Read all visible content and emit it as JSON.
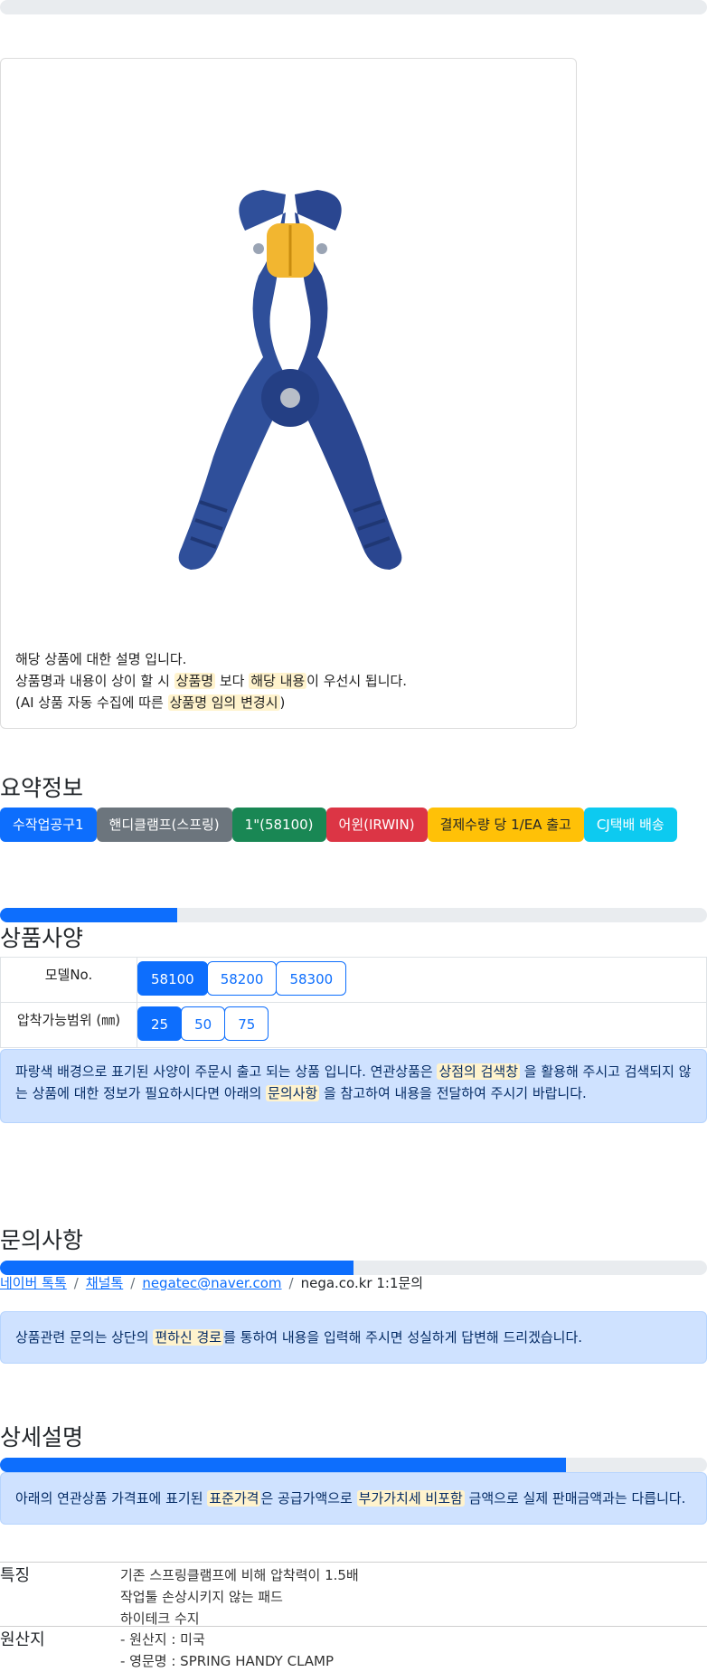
{
  "product": {
    "image_alt": "스프링 핸디 클램프",
    "description_lines": [
      "해당 상품에 대한 설명 입니다."
    ],
    "line2_pre": "상품명과 내용이 상이 할 시 ",
    "line2_hl1": "상품명",
    "line2_mid": " 보다 ",
    "line2_hl2": "해당 내용",
    "line2_post": "이 우선시 됩니다.",
    "line3_pre": "(AI 상품 자동 수집에 따른 ",
    "line3_hl": "상품명 임의 변경시",
    "line3_post": ")"
  },
  "summary": {
    "title": "요약정보",
    "badges": [
      {
        "label": "수작업공구1",
        "color": "#0d6efd"
      },
      {
        "label": "핸디클램프(스프링)",
        "color": "#6c757d"
      },
      {
        "label": "1\"(58100)",
        "color": "#198754"
      },
      {
        "label": "어윈(IRWIN)",
        "color": "#dc3545"
      },
      {
        "label": "결제수량 당 1/EA 출고",
        "color": "#ffc107"
      },
      {
        "label": "CJ택배 배송",
        "color": "#0dcaf0"
      }
    ]
  },
  "specs": {
    "title": "상품사양",
    "progress_fraction": 0.25,
    "rows": [
      {
        "label": "모델No.",
        "options": [
          "58100",
          "58200",
          "58300"
        ],
        "selected": "58100"
      },
      {
        "label": "압착가능범위 (㎜)",
        "options": [
          "25",
          "50",
          "75"
        ],
        "selected": "25"
      }
    ],
    "note_pre": "파랑색 배경으로 표기된 사양이 주문시 출고 되는 상품 입니다. 연관상품은 ",
    "note_hl1": "상점의 검색창",
    "note_mid": " 을 활용해 주시고 검색되지 않는 상품에 대한 정보가 필요하시다면 아래의 ",
    "note_hl2": "문의사항",
    "note_post": " 을 참고하여 내용을 전달하여 주시기 바랍니다."
  },
  "inquiry": {
    "title": "문의사항",
    "progress_fraction": 0.5,
    "links": [
      "네이버 톡톡",
      "채널톡",
      "negatec@naver.com"
    ],
    "plain": "nega.co.kr 1:1문의",
    "note_pre": "상품관련 문의는 상단의 ",
    "note_hl": "편하신 경로",
    "note_post": "를 통하여 내용을 입력해 주시면 성실하게 답변해 드리겠습니다."
  },
  "detail": {
    "title": "상세설명",
    "progress_fraction": 0.8,
    "note_pre": "아래의 연관상품 가격표에 표기된 ",
    "note_hl1": "표준가격",
    "note_mid": "은 공급가액으로 ",
    "note_hl2": "부가가치세 비포함",
    "note_post": " 금액으로 실제 판매금액과는 다릅니다.",
    "features": [
      {
        "key": "특징",
        "values": [
          "기존 스프링클램프에 비해 압착력이 1.5배",
          "작업툴 손상시키지 않는 패드",
          "하이테크 수지"
        ]
      },
      {
        "key": "원산지",
        "values": [
          "- 원산지 : 미국",
          "- 영문명 : SPRING HANDY CLAMP"
        ]
      }
    ]
  },
  "colors": {
    "primary": "#0d6efd",
    "alert_bg": "#cfe2ff",
    "highlight": "#fff3cd"
  }
}
